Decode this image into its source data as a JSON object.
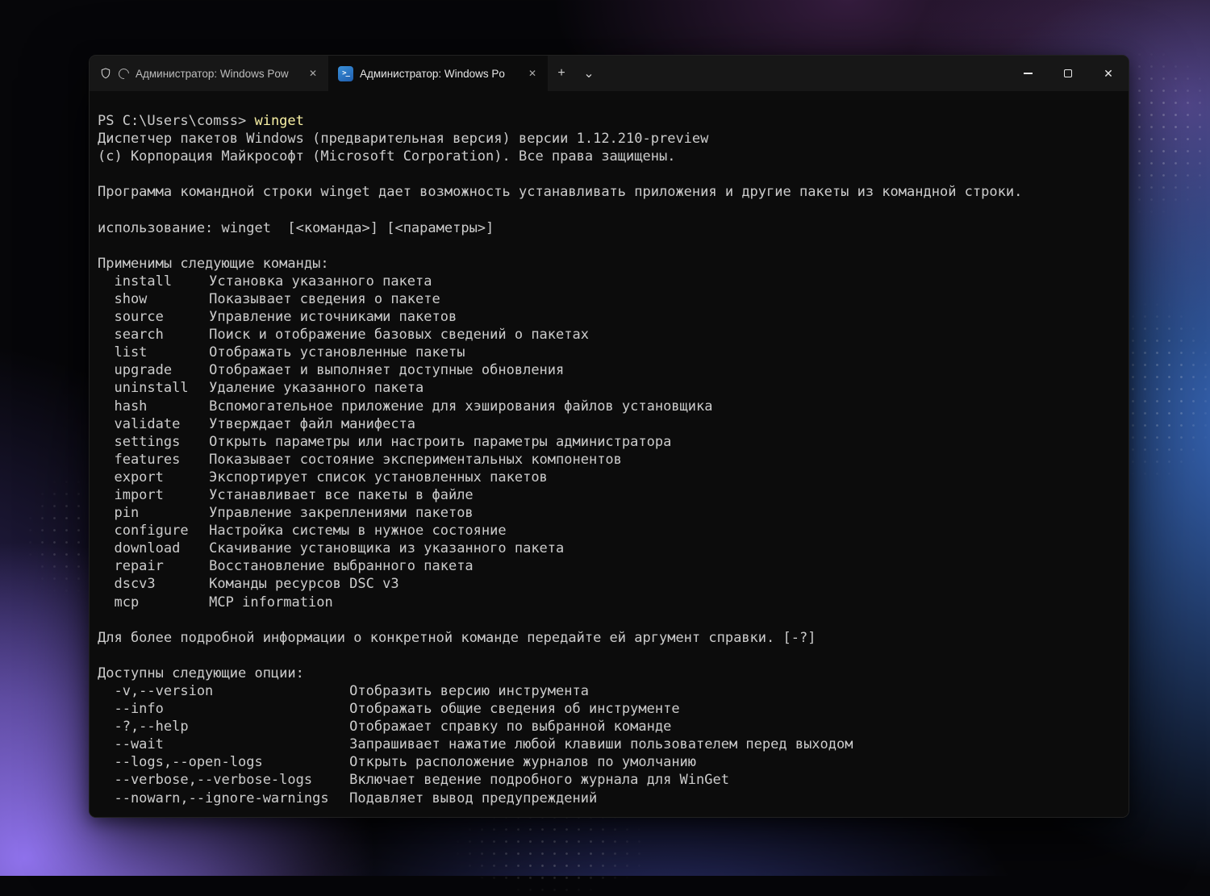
{
  "window": {
    "tabs": [
      {
        "label": "Администратор: Windows Pow",
        "active": false
      },
      {
        "label": "Администратор: Windows Po",
        "active": true
      }
    ],
    "glyphs": {
      "tab_close": "✕",
      "new_tab": "+",
      "tab_dropdown": "⌄",
      "window_close": "✕",
      "ps_icon": ">_"
    },
    "colors": {
      "titlebar_bg": "#171717",
      "terminal_bg": "#0c0c0c",
      "terminal_fg": "#cccccc",
      "command_yellow": "#F9F1A5",
      "ps_icon_blue": "#2e7bd6"
    }
  },
  "terminal": {
    "prompt": "PS C:\\Users\\comss> ",
    "command": "winget",
    "version_line": "Диспетчер пакетов Windows (предварительная версия) версии 1.12.210-preview",
    "copyright_line": "(c) Корпорация Майкрософт (Microsoft Corporation). Все права защищены.",
    "description": "Программа командной строки winget дает возможность устанавливать приложения и другие пакеты из командной строки.",
    "usage": "использование: winget  [<команда>] [<параметры>]",
    "commands_title": "Применимы следующие команды:",
    "commands": [
      {
        "name": "install",
        "desc": "Установка указанного пакета"
      },
      {
        "name": "show",
        "desc": "Показывает сведения о пакете"
      },
      {
        "name": "source",
        "desc": "Управление источниками пакетов"
      },
      {
        "name": "search",
        "desc": "Поиск и отображение базовых сведений о пакетах"
      },
      {
        "name": "list",
        "desc": "Отображать установленные пакеты"
      },
      {
        "name": "upgrade",
        "desc": "Отображает и выполняет доступные обновления"
      },
      {
        "name": "uninstall",
        "desc": "Удаление указанного пакета"
      },
      {
        "name": "hash",
        "desc": "Вспомогательное приложение для хэширования файлов установщика"
      },
      {
        "name": "validate",
        "desc": "Утверждает файл манифеста"
      },
      {
        "name": "settings",
        "desc": "Открыть параметры или настроить параметры администратора"
      },
      {
        "name": "features",
        "desc": "Показывает состояние экспериментальных компонентов"
      },
      {
        "name": "export",
        "desc": "Экспортирует список установленных пакетов"
      },
      {
        "name": "import",
        "desc": "Устанавливает все пакеты в файле"
      },
      {
        "name": "pin",
        "desc": "Управление закреплениями пакетов"
      },
      {
        "name": "configure",
        "desc": "Настройка системы в нужное состояние"
      },
      {
        "name": "download",
        "desc": "Скачивание установщика из указанного пакета"
      },
      {
        "name": "repair",
        "desc": "Восстановление выбранного пакета"
      },
      {
        "name": "dscv3",
        "desc": "Команды ресурсов DSC v3"
      },
      {
        "name": "mcp",
        "desc": "MCP information"
      }
    ],
    "help_note": "Для более подробной информации о конкретной команде передайте ей аргумент справки. [-?]",
    "options_title": "Доступны следующие опции:",
    "options": [
      {
        "name": "-v,--version",
        "desc": "Отобразить версию инструмента"
      },
      {
        "name": "--info",
        "desc": "Отображать общие сведения об инструменте"
      },
      {
        "name": "-?,--help",
        "desc": "Отображает справку по выбранной команде"
      },
      {
        "name": "--wait",
        "desc": "Запрашивает нажатие любой клавиши пользователем перед выходом"
      },
      {
        "name": "--logs,--open-logs",
        "desc": "Открыть расположение журналов по умолчанию"
      },
      {
        "name": "--verbose,--verbose-logs",
        "desc": "Включает ведение подробного журнала для WinGet"
      },
      {
        "name": "--nowarn,--ignore-warnings",
        "desc": "Подавляет вывод предупреждений"
      }
    ]
  }
}
